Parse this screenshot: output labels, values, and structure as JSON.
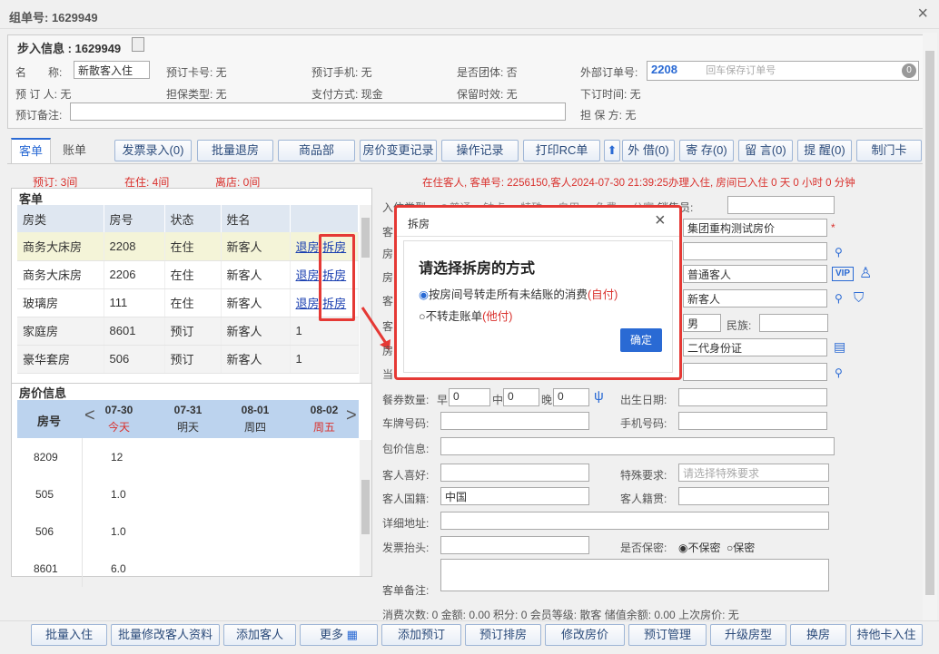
{
  "window": {
    "title": "组单号: 1629949",
    "close": "×"
  },
  "step": {
    "title": "步入信息 : 1629949",
    "name_label": "名　　称:",
    "name_value": "新散客入住",
    "card_label": "预订卡号: 无",
    "phone_label": "预订手机: 无",
    "group_label": "是否团体: 否",
    "ext_label": "外部订单号:",
    "ext_value": "2208",
    "ext_placeholder": "回车保存订单号",
    "ext_count": "0",
    "booker_label": "预 订 人: 无",
    "guarantee_type": "担保类型: 无",
    "pay_label": "支付方式: 现金",
    "keep_label": "保留时效: 无",
    "order_time": "下订时间: 无",
    "remark_label": "预订备注:",
    "guarantor": "担 保 方: 无"
  },
  "tabs": [
    "客单",
    "账单"
  ],
  "toolbar": [
    "发票录入(0)",
    "批量退房",
    "商品部",
    "房价变更记录",
    "操作记录",
    "打印RC单",
    "外 借(0)",
    "寄 存(0)",
    "留 言(0)",
    "提 醒(0)",
    "制门卡"
  ],
  "stats": {
    "booked": "预订: 3间",
    "in": "在住: 4间",
    "leave": "离店: 0间"
  },
  "status_line": "在住客人, 客单号: 2256150,客人2024-07-30 21:39:25办理入住, 房间已入住 0 天 0 小时 0 分钟",
  "guest_section": "客单",
  "guest_table": {
    "headers": [
      "房类",
      "房号",
      "状态",
      "姓名"
    ],
    "rows": [
      {
        "type": "商务大床房",
        "no": "2208",
        "status": "在住",
        "name": "新客人",
        "a": "退房",
        "b": "拆房"
      },
      {
        "type": "商务大床房",
        "no": "2206",
        "status": "在住",
        "name": "新客人",
        "a": "退房",
        "b": "拆房"
      },
      {
        "type": "玻璃房",
        "no": "111",
        "status": "在住",
        "name": "新客人",
        "a": "退房",
        "b": "拆房"
      },
      {
        "type": "家庭房",
        "no": "8601",
        "status": "预订",
        "name": "新客人",
        "a": "1",
        "b": ""
      },
      {
        "type": "豪华套房",
        "no": "506",
        "status": "预订",
        "name": "新客人",
        "a": "1",
        "b": ""
      }
    ]
  },
  "rate_section": "房价信息",
  "rate_table": {
    "first": "房号",
    "days": [
      {
        "d": "07-30",
        "w": "今天"
      },
      {
        "d": "07-31",
        "w": "明天"
      },
      {
        "d": "08-01",
        "w": "周四"
      },
      {
        "d": "08-02",
        "w": "周五"
      }
    ],
    "rows": [
      [
        "8209",
        "12"
      ],
      [
        "505",
        "1.0"
      ],
      [
        "506",
        "1.0"
      ],
      [
        "8601",
        "6.0"
      ]
    ]
  },
  "form": {
    "type_label": "入住类型:",
    "type_opts": [
      "普通",
      "钟点",
      "特殊",
      "自用",
      "免费",
      "公寓"
    ],
    "seller": "销售员:",
    "price_plan": "集团重构测试房价",
    "guest_type": "普通客人",
    "guest_name": "新客人",
    "gender": "男",
    "nation": "民族:",
    "id_type": "二代身份证",
    "meal": "餐券数量:",
    "breakfast": "早",
    "lunch": "中",
    "dinner": "晚",
    "meal_val": "0",
    "birth": "出生日期:",
    "plate": "车牌号码:",
    "mobile": "手机号码:",
    "package": "包价信息:",
    "hobby": "客人喜好:",
    "special": "特殊要求:",
    "special_ph": "请选择特殊要求",
    "nationality": "客人国籍:",
    "nationality_val": "中国",
    "native": "客人籍贯:",
    "address": "详细地址:",
    "invoice": "发票抬头:",
    "secret": "是否保密:",
    "secret_a": "不保密",
    "secret_b": "保密",
    "remark": "客单备注:",
    "summary": "消费次数: 0 金额: 0.00 积分: 0 会员等级: 散客 储值余额: 0.00 上次房价: 无"
  },
  "bottom": [
    "批量入住",
    "批量修改客人资料",
    "添加客人",
    "更多",
    "添加预订",
    "预订排房",
    "修改房价",
    "预订管理",
    "升级房型",
    "换房",
    "持他卡入住"
  ],
  "dialog": {
    "title": "拆房",
    "heading": "请选择拆房的方式",
    "opt1": "按房间号转走所有未结账的消费",
    "opt1_tag": "(自付)",
    "opt2": "不转走账单",
    "opt2_tag": "(他付)",
    "ok": "确定"
  },
  "colors": {
    "accent": "#2a6ad4",
    "highlight": "#e53935"
  }
}
